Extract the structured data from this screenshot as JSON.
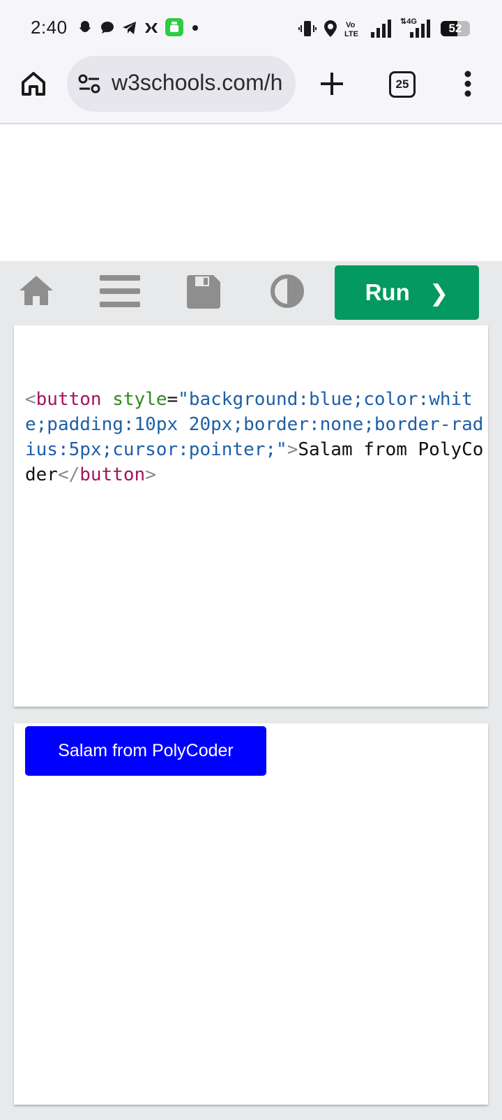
{
  "status_bar": {
    "time": "2:40",
    "battery_level": "52",
    "notification_icons": [
      "snapchat-icon",
      "chat-bubble-icon",
      "telegram-icon",
      "capcut-icon",
      "app-icon",
      "dot-icon"
    ],
    "system_icons": [
      "vibrate-icon",
      "location-icon",
      "volte-icon",
      "signal-icon",
      "4g-signal-icon",
      "battery-icon"
    ],
    "network_label": "Vo LTE",
    "data_label": "4G"
  },
  "browser": {
    "url": "w3schools.com/h",
    "tab_count": "25",
    "icons": [
      "home-icon",
      "site-settings-icon",
      "new-tab-icon",
      "tabs-icon",
      "more-menu-icon"
    ]
  },
  "toolbar": {
    "run_label": "Run",
    "run_arrow": "❯",
    "icons": [
      "home-icon",
      "menu-icon",
      "save-icon",
      "contrast-icon"
    ]
  },
  "code": {
    "open_bracket": "<",
    "tag": "button",
    "space": " ",
    "attr": "style",
    "equals": "=",
    "value": "\"background:blue;color:white;padding:10px 20px;border:none;border-radius:5px;cursor:pointer;\"",
    "close_bracket": ">",
    "text": "Salam from PolyCoder",
    "end_open": "</",
    "end_tag": "button",
    "end_close": ">"
  },
  "result": {
    "button_label": "Salam from PolyCoder",
    "button_color": "#0000ff"
  },
  "colors": {
    "run_green": "#04995e",
    "workspace_gray": "#e7e9eb",
    "tag_color": "#a3145f",
    "attr_color": "#2e8b1b",
    "value_color": "#1d5fa8"
  }
}
